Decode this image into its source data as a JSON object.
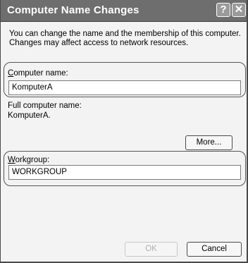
{
  "window": {
    "title": "Computer Name Changes"
  },
  "titlebar": {
    "help_icon": "?",
    "close_icon": "✕"
  },
  "intro_text": "You can change the name and the membership of this computer. Changes may affect access to network resources.",
  "computer_name": {
    "label_first": "C",
    "label_rest": "omputer name:",
    "value": "KomputerA"
  },
  "full_name": {
    "label": "Full computer name:",
    "value": "KomputerA."
  },
  "buttons": {
    "more": "More...",
    "ok": "OK",
    "cancel": "Cancel"
  },
  "workgroup": {
    "label_first": "W",
    "label_rest": "orkgroup:",
    "value": "WORKGROUP"
  }
}
